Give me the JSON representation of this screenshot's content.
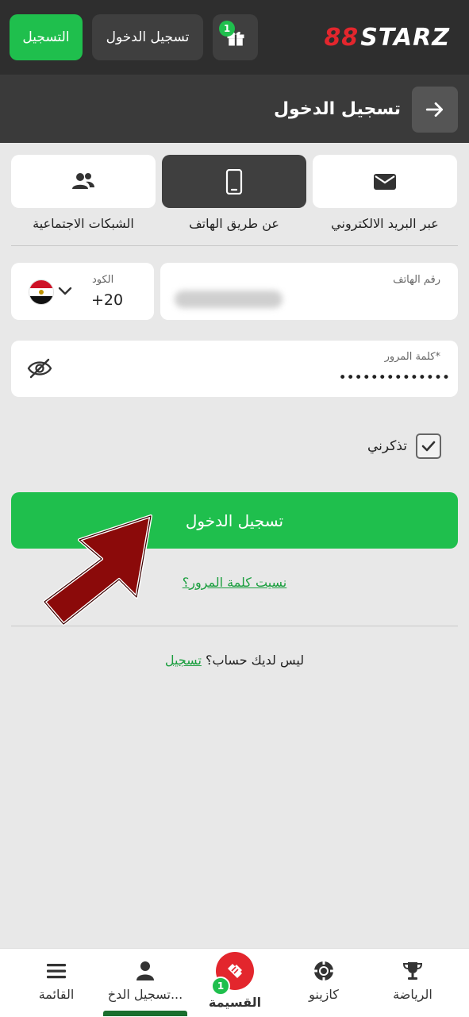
{
  "header": {
    "register_label": "التسجيل",
    "login_label": "تسجيل الدخول",
    "gift_badge": "1",
    "logo_mark": "88",
    "logo_text": "STARZ",
    "brand_green": "#1fbf4d",
    "brand_red": "#e3262d"
  },
  "title_bar": {
    "title": "تسجيل الدخول",
    "back_icon": "arrow-right-icon"
  },
  "methods": [
    {
      "label": "عبر البريد الالكتروني",
      "icon": "envelope-icon",
      "active": false
    },
    {
      "label": "عن طريق الهاتف",
      "icon": "phone-icon",
      "active": true
    },
    {
      "label": "الشبكات الاجتماعية",
      "icon": "users-icon",
      "active": false
    }
  ],
  "form": {
    "phone_label": "رقم الهاتف",
    "code_label": "الكود",
    "code_value": "+20",
    "country_flag": "egypt-flag",
    "password_label": "كلمة المرور*",
    "password_value": "••••••••••••••",
    "remember_label": "تذكرني",
    "remember_checked": true,
    "submit_label": "تسجيل الدخول",
    "forgot_label": "نسيت كلمة المرور؟",
    "no_account_text": "ليس لديك حساب؟",
    "register_link": "تسجيل"
  },
  "bottom_nav": {
    "items": [
      {
        "label": "القائمة",
        "icon": "menu-icon"
      },
      {
        "label": "تسجيل الدخ...",
        "icon": "user-icon"
      },
      {
        "label": "القسيمة",
        "icon": "ticket-icon",
        "badge": "1"
      },
      {
        "label": "كازينو",
        "icon": "casino-chip-icon"
      },
      {
        "label": "الرياضة",
        "icon": "trophy-icon"
      }
    ]
  }
}
